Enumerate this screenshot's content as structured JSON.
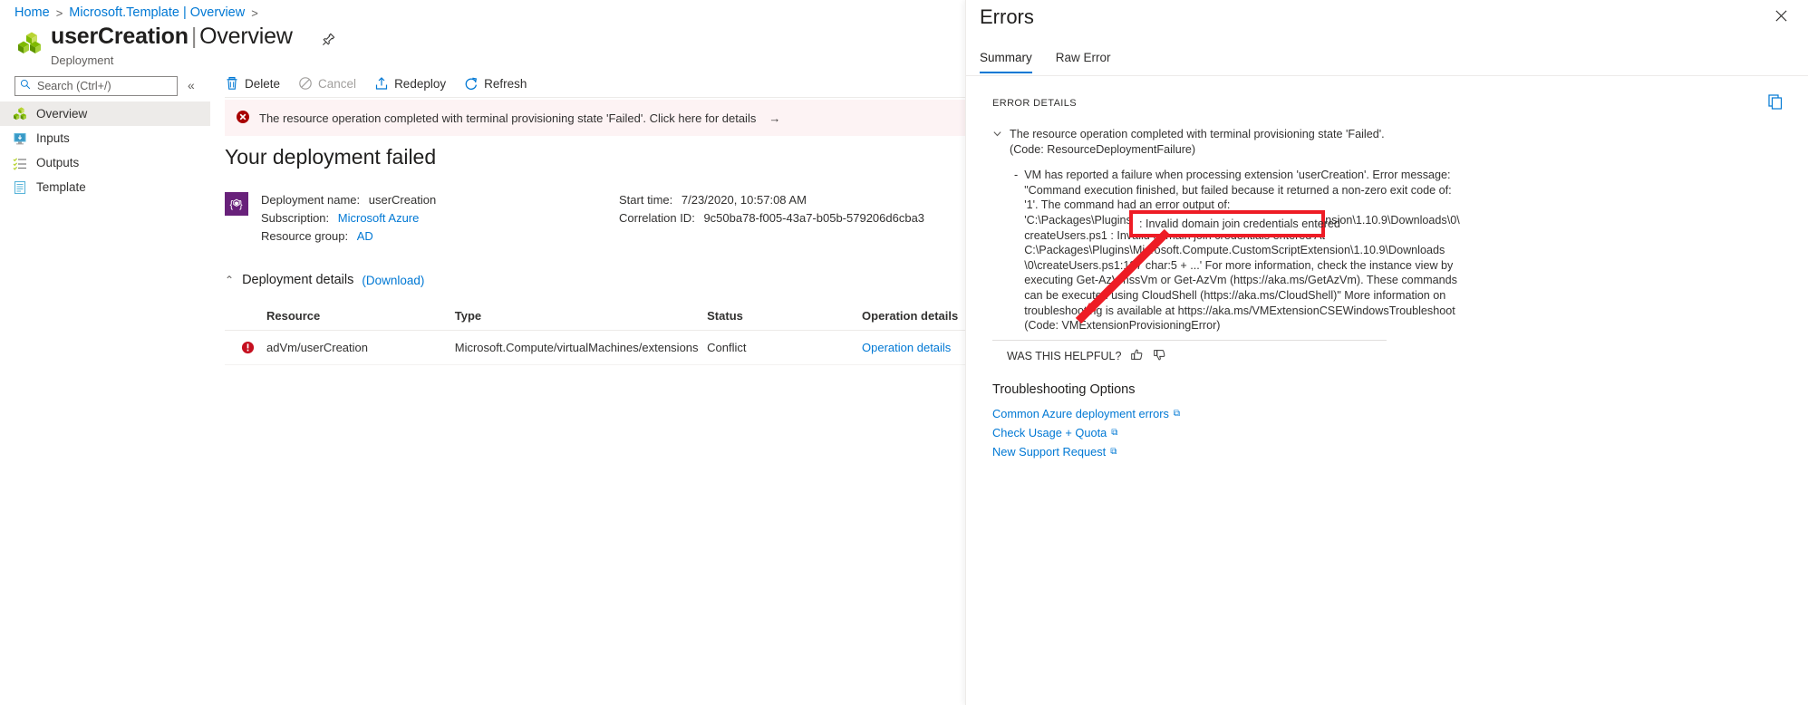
{
  "breadcrumb": {
    "home": "Home",
    "sep": ">",
    "item": "Microsoft.Template | Overview",
    "trail_sep": ">"
  },
  "header": {
    "title_bold": "userCreation",
    "title_bar": "|",
    "title_light": "Overview",
    "subtitle": "Deployment",
    "resource_icon": "deployment-cubes-icon",
    "pin_icon": "pin-icon"
  },
  "search": {
    "placeholder": "Search (Ctrl+/)",
    "value": "",
    "icon": "search-icon"
  },
  "collapse": {
    "glyph": "«"
  },
  "sidebar": {
    "items": [
      {
        "label": "Overview",
        "icon": "overview-cubes-icon",
        "active": true
      },
      {
        "label": "Inputs",
        "icon": "inputs-monitor-icon",
        "active": false
      },
      {
        "label": "Outputs",
        "icon": "outputs-list-icon",
        "active": false
      },
      {
        "label": "Template",
        "icon": "template-document-icon",
        "active": false
      }
    ]
  },
  "toolbar": {
    "delete": "Delete",
    "cancel": "Cancel",
    "redeploy": "Redeploy",
    "refresh": "Refresh",
    "delete_icon": "trash-icon",
    "cancel_icon": "ban-circle-icon",
    "redeploy_icon": "upload-box-icon",
    "refresh_icon": "refresh-circle-icon"
  },
  "banner": {
    "icon": "error-circle-icon",
    "message": "The resource operation completed with terminal provisioning state 'Failed'. Click here for details",
    "arrow": "→",
    "background": "#fdf3f4",
    "icon_color": "#a80000"
  },
  "main": {
    "heading": "Your deployment failed",
    "deployment_icon": "arm-template-icon",
    "meta_left": [
      {
        "label": "Deployment name:",
        "value": "userCreation",
        "link": false
      },
      {
        "label": "Subscription:",
        "value": "Microsoft Azure",
        "link": true
      },
      {
        "label": "Resource group:",
        "value": "AD",
        "link": true
      }
    ],
    "meta_right": [
      {
        "label": "Start time:",
        "value": "7/23/2020, 10:57:08 AM",
        "link": false
      },
      {
        "label": "Correlation ID:",
        "value": "9c50ba78-f005-43a7-b05b-579206d6cba3",
        "link": false
      }
    ],
    "details_chevron": "⌃",
    "details_title": "Deployment details",
    "download_link": "(Download)",
    "table": {
      "columns": [
        "Resource",
        "Type",
        "Status",
        "Operation details"
      ],
      "rows": [
        {
          "resource": "adVm/userCreation",
          "type": "Microsoft.Compute/virtualMachines/extensions",
          "status": "Conflict",
          "operation": "Operation details",
          "status_icon": "error-circle-icon"
        }
      ]
    }
  },
  "panel": {
    "title": "Errors",
    "close_icon": "close-icon",
    "tabs": [
      {
        "label": "Summary",
        "active": true
      },
      {
        "label": "Raw Error",
        "active": false
      }
    ],
    "error_details_label": "ERROR DETAILS",
    "copy_icon": "copy-icon",
    "error_top": "The resource operation completed with terminal provisioning state 'Failed'. (Code: ResourceDeploymentFailure)",
    "error_detail": "VM has reported a failure when processing extension 'userCreation'. Error message: \"Command execution finished, but failed because it returned a non-zero exit code of: '1'. The command had an error output of: 'C:\\Packages\\Plugins\\Microsoft.Compute.CustomScriptExtension\\1.10.9\\Downloads\\0\\ createUsers.ps1 : Invalid domain join credentials entered At C:\\Packages\\Plugins\\Microsoft.Compute.CustomScriptExtension\\1.10.9\\Downloads \\0\\createUsers.ps1:137 char:5 + ...' For more information, check the instance view by executing Get-AzVmssVm or Get-AzVm (https://aka.ms/GetAzVm). These commands can be executed using CloudShell (https://aka.ms/CloudShell)\" More information on troubleshooting is available at https://aka.ms/VMExtensionCSEWindowsTroubleshoot (Code: VMExtensionProvisioningError)",
    "helpful_label": "WAS THIS HELPFUL?",
    "thumbs_up_icon": "thumbs-up-icon",
    "thumbs_down_icon": "thumbs-down-icon",
    "troubleshooting_title": "Troubleshooting Options",
    "troubleshooting_links": [
      {
        "label": "Common Azure deployment errors",
        "icon": "external-link-icon"
      },
      {
        "label": "Check Usage + Quota",
        "icon": "external-link-icon"
      },
      {
        "label": "New Support Request",
        "icon": "external-link-icon"
      }
    ]
  },
  "annotation": {
    "highlight_text": ": Invalid domain join credentials entered",
    "highlight_color": "#ee1c25",
    "arrow_icon": "red-arrow-annotation"
  },
  "colors": {
    "accent": "#0078d4",
    "error": "#a80000",
    "purple": "#68217a",
    "annotation_red": "#ee1c25"
  }
}
